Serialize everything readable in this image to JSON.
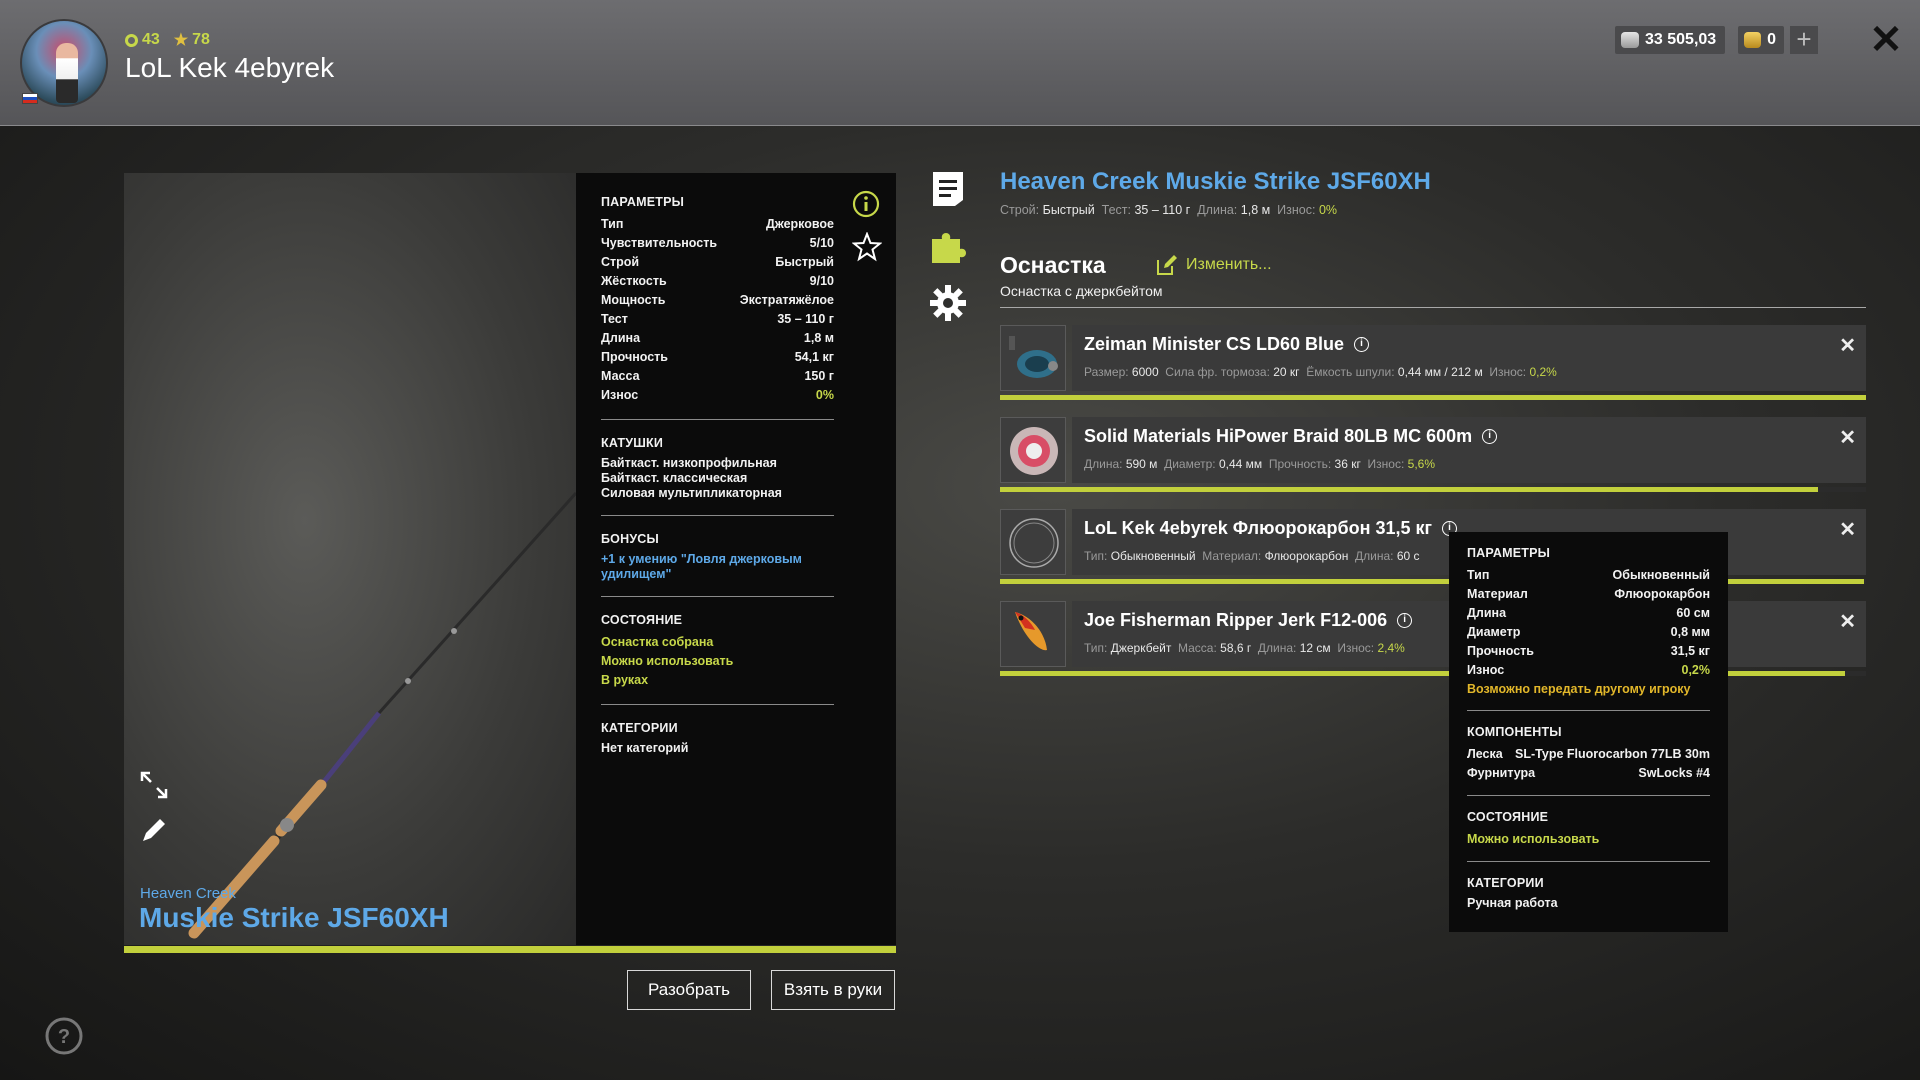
{
  "header": {
    "level": "43",
    "stars": "78",
    "player_name": "LoL Kek 4ebyrek",
    "silver": "33 505,03",
    "gold": "0",
    "add_label": "+",
    "close_label": "✕"
  },
  "rod": {
    "brand": "Heaven Creek",
    "model": "Muskie Strike JSF60XH",
    "progress_fraction": 1.0,
    "params_title": "ПАРАМЕТРЫ",
    "params": [
      {
        "k": "Тип",
        "v": "Джерковое"
      },
      {
        "k": "Чувствительность",
        "v": "5/10"
      },
      {
        "k": "Строй",
        "v": "Быстрый"
      },
      {
        "k": "Жёсткость",
        "v": "9/10"
      },
      {
        "k": "Мощность",
        "v": "Экстратяжёлое"
      },
      {
        "k": "Тест",
        "v": "35 – 110 г"
      },
      {
        "k": "Длина",
        "v": "1,8 м"
      },
      {
        "k": "Прочность",
        "v": "54,1 кг"
      },
      {
        "k": "Масса",
        "v": "150 г"
      },
      {
        "k": "Износ",
        "v": "0%"
      }
    ],
    "reels_title": "КАТУШКИ",
    "reels": [
      "Байткаст. низкопрофильная",
      "Байткаст. классическая",
      "Силовая мультипликаторная"
    ],
    "bonus_title": "БОНУСЫ",
    "bonus_line1": "+1 к умению \"Ловля джерковым",
    "bonus_line2": "удилищем\"",
    "state_title": "СОСТОЯНИЕ",
    "states": [
      "Оснастка собрана",
      "Можно использовать",
      "В руках"
    ],
    "cat_title": "КАТЕГОРИИ",
    "category": "Нет категорий"
  },
  "buttons": {
    "disassemble": "Разобрать",
    "take": "Взять в руки"
  },
  "detail": {
    "title": "Heaven Creek Muskie Strike JSF60XH",
    "meta_k1": "Строй:",
    "meta_v1": "Быстрый",
    "meta_k2": "Тест:",
    "meta_v2": "35 – 110 г",
    "meta_k3": "Длина:",
    "meta_v3": "1,8 м",
    "meta_k4": "Износ:",
    "meta_v4": "0%",
    "rig_label": "Оснастка",
    "rig_change": "Изменить...",
    "rig_sub": "Оснастка с джеркбейтом"
  },
  "slots": [
    {
      "name": "Zeiman Minister CS LD60 Blue",
      "k1": "Размер:",
      "v1": "6000",
      "k2": "Сила фр. тормоза:",
      "v2": "20 кг",
      "k3": "Ёмкость шпули:",
      "v3": "0,44 мм / 212 м",
      "k4": "Износ:",
      "v4": "0,2%",
      "condition_fraction": 1.0
    },
    {
      "name": "Solid Materials HiPower Braid 80LB MC 600m",
      "k1": "Длина:",
      "v1": "590 м",
      "k2": "Диаметр:",
      "v2": "0,44 мм",
      "k3": "Прочность:",
      "v3": "36 кг",
      "k4": "Износ:",
      "v4": "5,6%",
      "condition_fraction": 0.944
    },
    {
      "name": "LoL Kek 4ebyrek Флюорокарбон 31,5 кг",
      "k1": "Тип:",
      "v1": "Обыкновенный",
      "k2": "Материал:",
      "v2": "Флюорокарбон",
      "k3": "Длина:",
      "v3": "60 с",
      "condition_fraction": 0.998
    },
    {
      "name": "Joe Fisherman Ripper Jerk F12-006",
      "k1": "Тип:",
      "v1": "Джеркбейт",
      "k2": "Масса:",
      "v2": "58,6 г",
      "k3": "Длина:",
      "v3": "12 см",
      "k4": "Износ:",
      "v4": "2,4%",
      "condition_fraction": 0.976
    }
  ],
  "tooltip": {
    "params_title": "ПАРАМЕТРЫ",
    "params": [
      {
        "k": "Тип",
        "v": "Обыкновенный"
      },
      {
        "k": "Материал",
        "v": "Флюорокарбон"
      },
      {
        "k": "Длина",
        "v": "60 см"
      },
      {
        "k": "Диаметр",
        "v": "0,8 мм"
      },
      {
        "k": "Прочность",
        "v": "31,5 кг"
      },
      {
        "k": "Износ",
        "v": "0,2%"
      }
    ],
    "transfer": "Возможно передать другому игроку",
    "components_title": "КОМПОНЕНТЫ",
    "components": [
      {
        "k": "Леска",
        "v": "SL-Type Fluorocarbon 77LB 30m"
      },
      {
        "k": "Фурнитура",
        "v": "SwLocks #4"
      }
    ],
    "state_title": "СОСТОЯНИЕ",
    "state": "Можно использовать",
    "cat_title": "КАТЕГОРИИ",
    "category": "Ручная работа"
  },
  "colors": {
    "accent_green": "#c7d84a",
    "accent_blue": "#5ea9e8",
    "accent_orange": "#e2b72a"
  }
}
